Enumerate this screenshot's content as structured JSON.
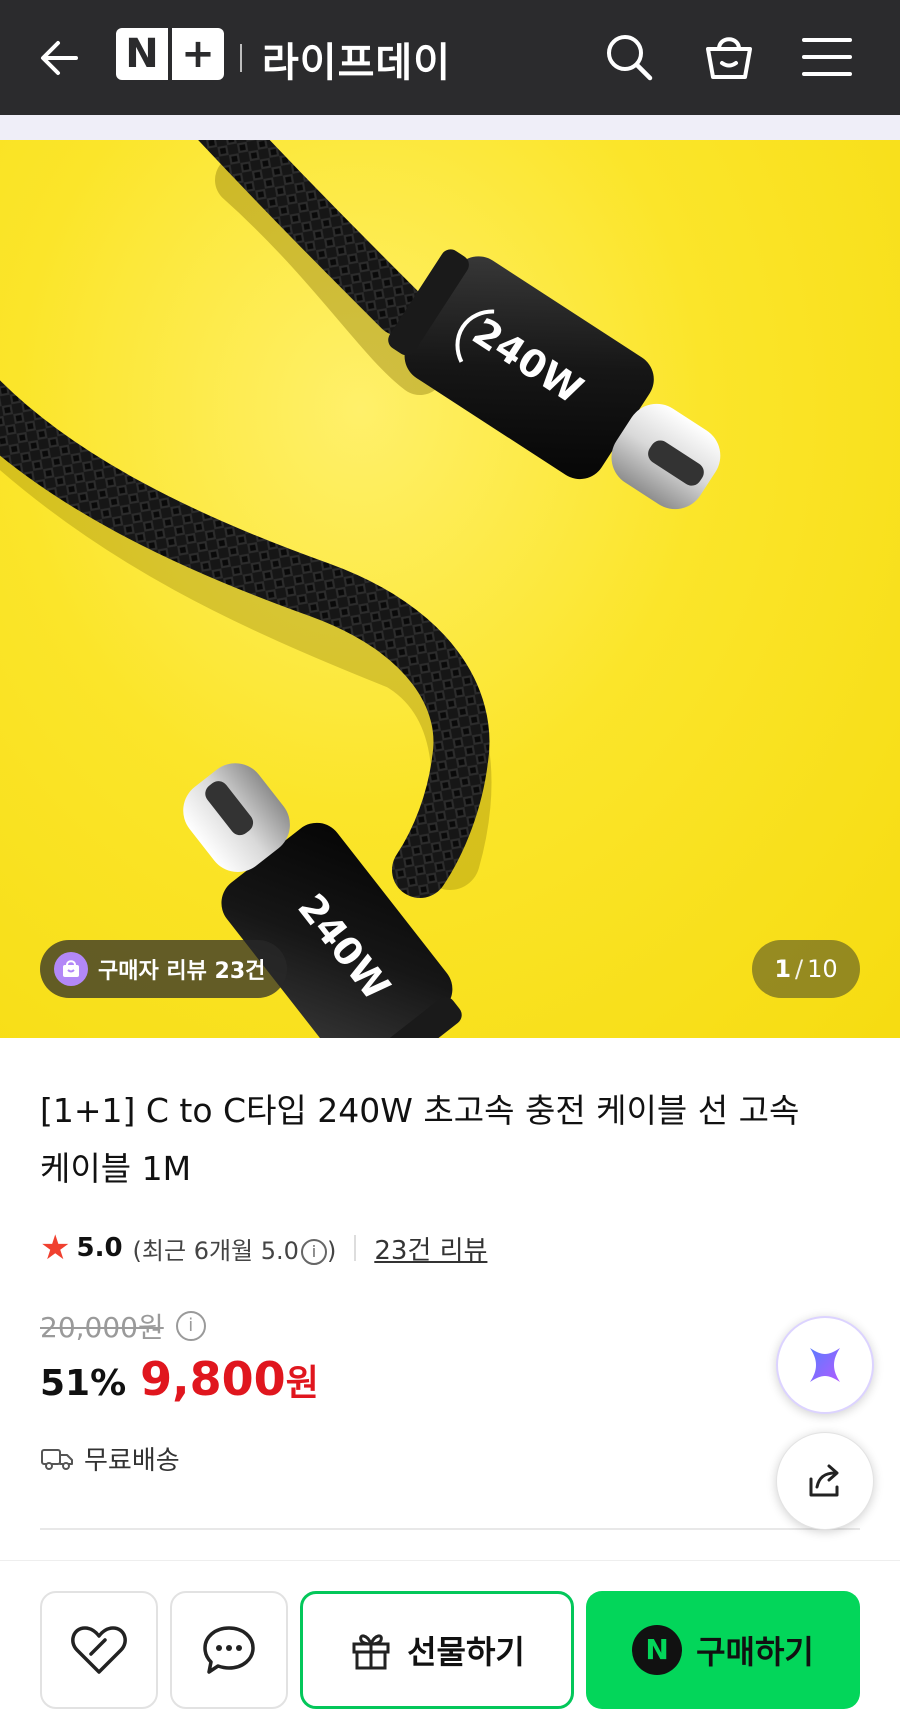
{
  "header": {
    "back_icon": "arrow-left-icon",
    "logo_n": "N",
    "logo_plus": "+",
    "store_name": "라이프데이",
    "search_icon": "search-icon",
    "cart_icon": "shopping-basket-icon",
    "menu_icon": "hamburger-menu-icon",
    "background": "#2b2b2d"
  },
  "hero": {
    "connector_marking": "240W",
    "review_badge": "구매자 리뷰 23건",
    "pager_current": "1",
    "pager_separator": "/",
    "pager_total": "10",
    "background": "#fbe52a"
  },
  "product": {
    "title": "[1+1] C to C타입 240W 초고속 충전 케이블 선 고속 케이블 1M",
    "rating_score": "5.0",
    "rating_recent": "(최근 6개월 5.0",
    "rating_recent_close": ")",
    "info_glyph": "i",
    "review_link": "23건 리뷰",
    "original_price": "20,000원",
    "discount": "51%",
    "sale_price": "9,800",
    "sale_price_unit": "원",
    "shipping": "무료배송"
  },
  "bottom_bar": {
    "gift_label": "선물하기",
    "buy_badge": "N",
    "buy_label": "구매하기"
  },
  "colors": {
    "price_red": "#e0161e",
    "naver_green": "#03d65a",
    "star": "#f0402f"
  }
}
